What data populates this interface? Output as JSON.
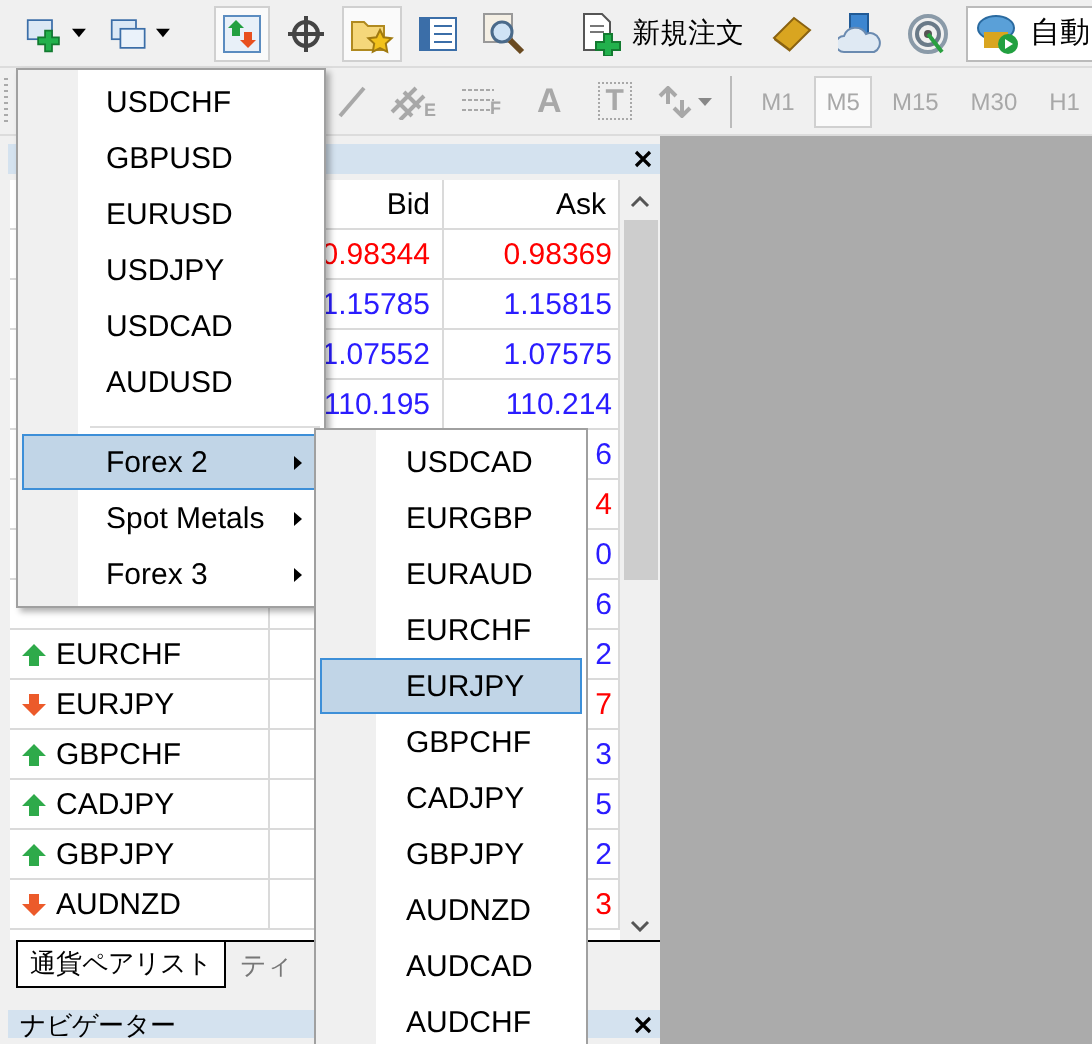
{
  "toolbar": {
    "new_order_label": "新規注文",
    "auto_trading_label": "自動"
  },
  "chart_toolbar": {
    "tools": [
      {
        "kind": "line"
      },
      {
        "kind": "channel",
        "label": "E"
      },
      {
        "kind": "fibo",
        "label": "F"
      },
      {
        "kind": "text",
        "label": "A"
      },
      {
        "kind": "textlabel",
        "label": "T"
      },
      {
        "kind": "arrows"
      }
    ],
    "timeframes": [
      {
        "label": "M1",
        "selected": false
      },
      {
        "label": "M5",
        "selected": true
      },
      {
        "label": "M15",
        "selected": false
      },
      {
        "label": "M30",
        "selected": false
      },
      {
        "label": "H1",
        "selected": false
      }
    ]
  },
  "market_watch": {
    "columns": [
      "Bid",
      "Ask"
    ],
    "rows": [
      {
        "bid": "0.98344",
        "ask": "0.98369",
        "rising": false
      },
      {
        "bid": "1.15785",
        "ask": "1.15815",
        "rising": true
      },
      {
        "bid": "1.07552",
        "ask": "1.07575",
        "rising": true
      },
      {
        "bid": "110.195",
        "ask": "110.214",
        "rising": true
      },
      {
        "ask": "6",
        "rising": true
      },
      {
        "ask": "4",
        "rising": false
      },
      {
        "ask": "0",
        "rising": true
      },
      {
        "ask": "6",
        "rising": true
      },
      {
        "symbol": "EURCHF",
        "up": true,
        "ask": "2",
        "rising": true
      },
      {
        "symbol": "EURJPY",
        "up": false,
        "ask": "7",
        "rising": false
      },
      {
        "symbol": "GBPCHF",
        "up": true,
        "ask": "3",
        "rising": true
      },
      {
        "symbol": "CADJPY",
        "up": true,
        "ask": "5",
        "rising": true
      },
      {
        "symbol": "GBPJPY",
        "up": true,
        "ask": "2",
        "rising": true
      },
      {
        "symbol": "AUDNZD",
        "up": false,
        "ask": "3",
        "rising": false
      }
    ],
    "tabs": [
      {
        "label": "通貨ペアリスト",
        "selected": true
      },
      {
        "label": "ティ",
        "selected": false
      }
    ]
  },
  "navigator": {
    "title": "ナビゲーター"
  },
  "symbol_menu": {
    "items": [
      {
        "kind": "item",
        "label": "USDCHF",
        "selected": false
      },
      {
        "kind": "item",
        "label": "GBPUSD",
        "selected": false
      },
      {
        "kind": "item",
        "label": "EURUSD",
        "selected": false
      },
      {
        "kind": "item",
        "label": "USDJPY",
        "selected": false
      },
      {
        "kind": "item",
        "label": "USDCAD",
        "selected": false
      },
      {
        "kind": "item",
        "label": "AUDUSD",
        "selected": false
      },
      {
        "kind": "separator"
      },
      {
        "kind": "submenu",
        "label": "Forex 2",
        "selected": true
      },
      {
        "kind": "submenu",
        "label": "Spot Metals",
        "selected": false
      },
      {
        "kind": "submenu",
        "label": "Forex 3",
        "selected": false
      }
    ]
  },
  "submenu": {
    "items": [
      {
        "label": "USDCAD",
        "selected": false
      },
      {
        "label": "EURGBP",
        "selected": false
      },
      {
        "label": "EURAUD",
        "selected": false
      },
      {
        "label": "EURCHF",
        "selected": false
      },
      {
        "label": "EURJPY",
        "selected": true
      },
      {
        "label": "GBPCHF",
        "selected": false
      },
      {
        "label": "CADJPY",
        "selected": false
      },
      {
        "label": "GBPJPY",
        "selected": false
      },
      {
        "label": "AUDNZD",
        "selected": false
      },
      {
        "label": "AUDCAD",
        "selected": false
      },
      {
        "label": "AUDCHF",
        "selected": false
      }
    ]
  }
}
